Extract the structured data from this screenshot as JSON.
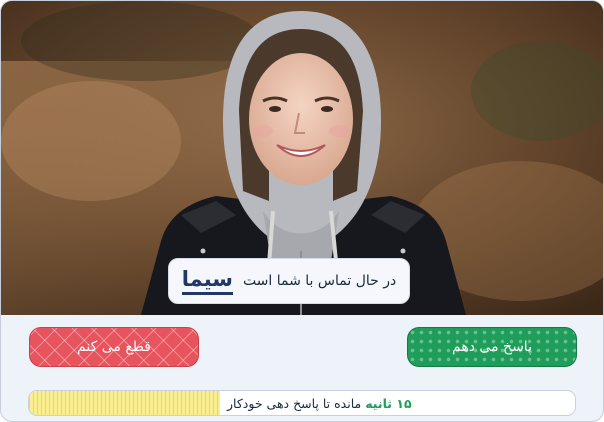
{
  "caller": {
    "name": "سیما",
    "message": "در حال تماس با شما است"
  },
  "actions": {
    "decline_label": "قطع می کنم",
    "accept_label": "پاسخ می دهم"
  },
  "auto_answer": {
    "seconds": "۱۵ ثانیه",
    "message": "مانده تا پاسخ دهی خودکار",
    "progress": 0.35
  },
  "colors": {
    "decline": "#e7545d",
    "accept": "#1f9d5b",
    "progress": "#fbee8e",
    "name": "#1f3868"
  },
  "icons": {
    "photo": "caller-photo"
  }
}
